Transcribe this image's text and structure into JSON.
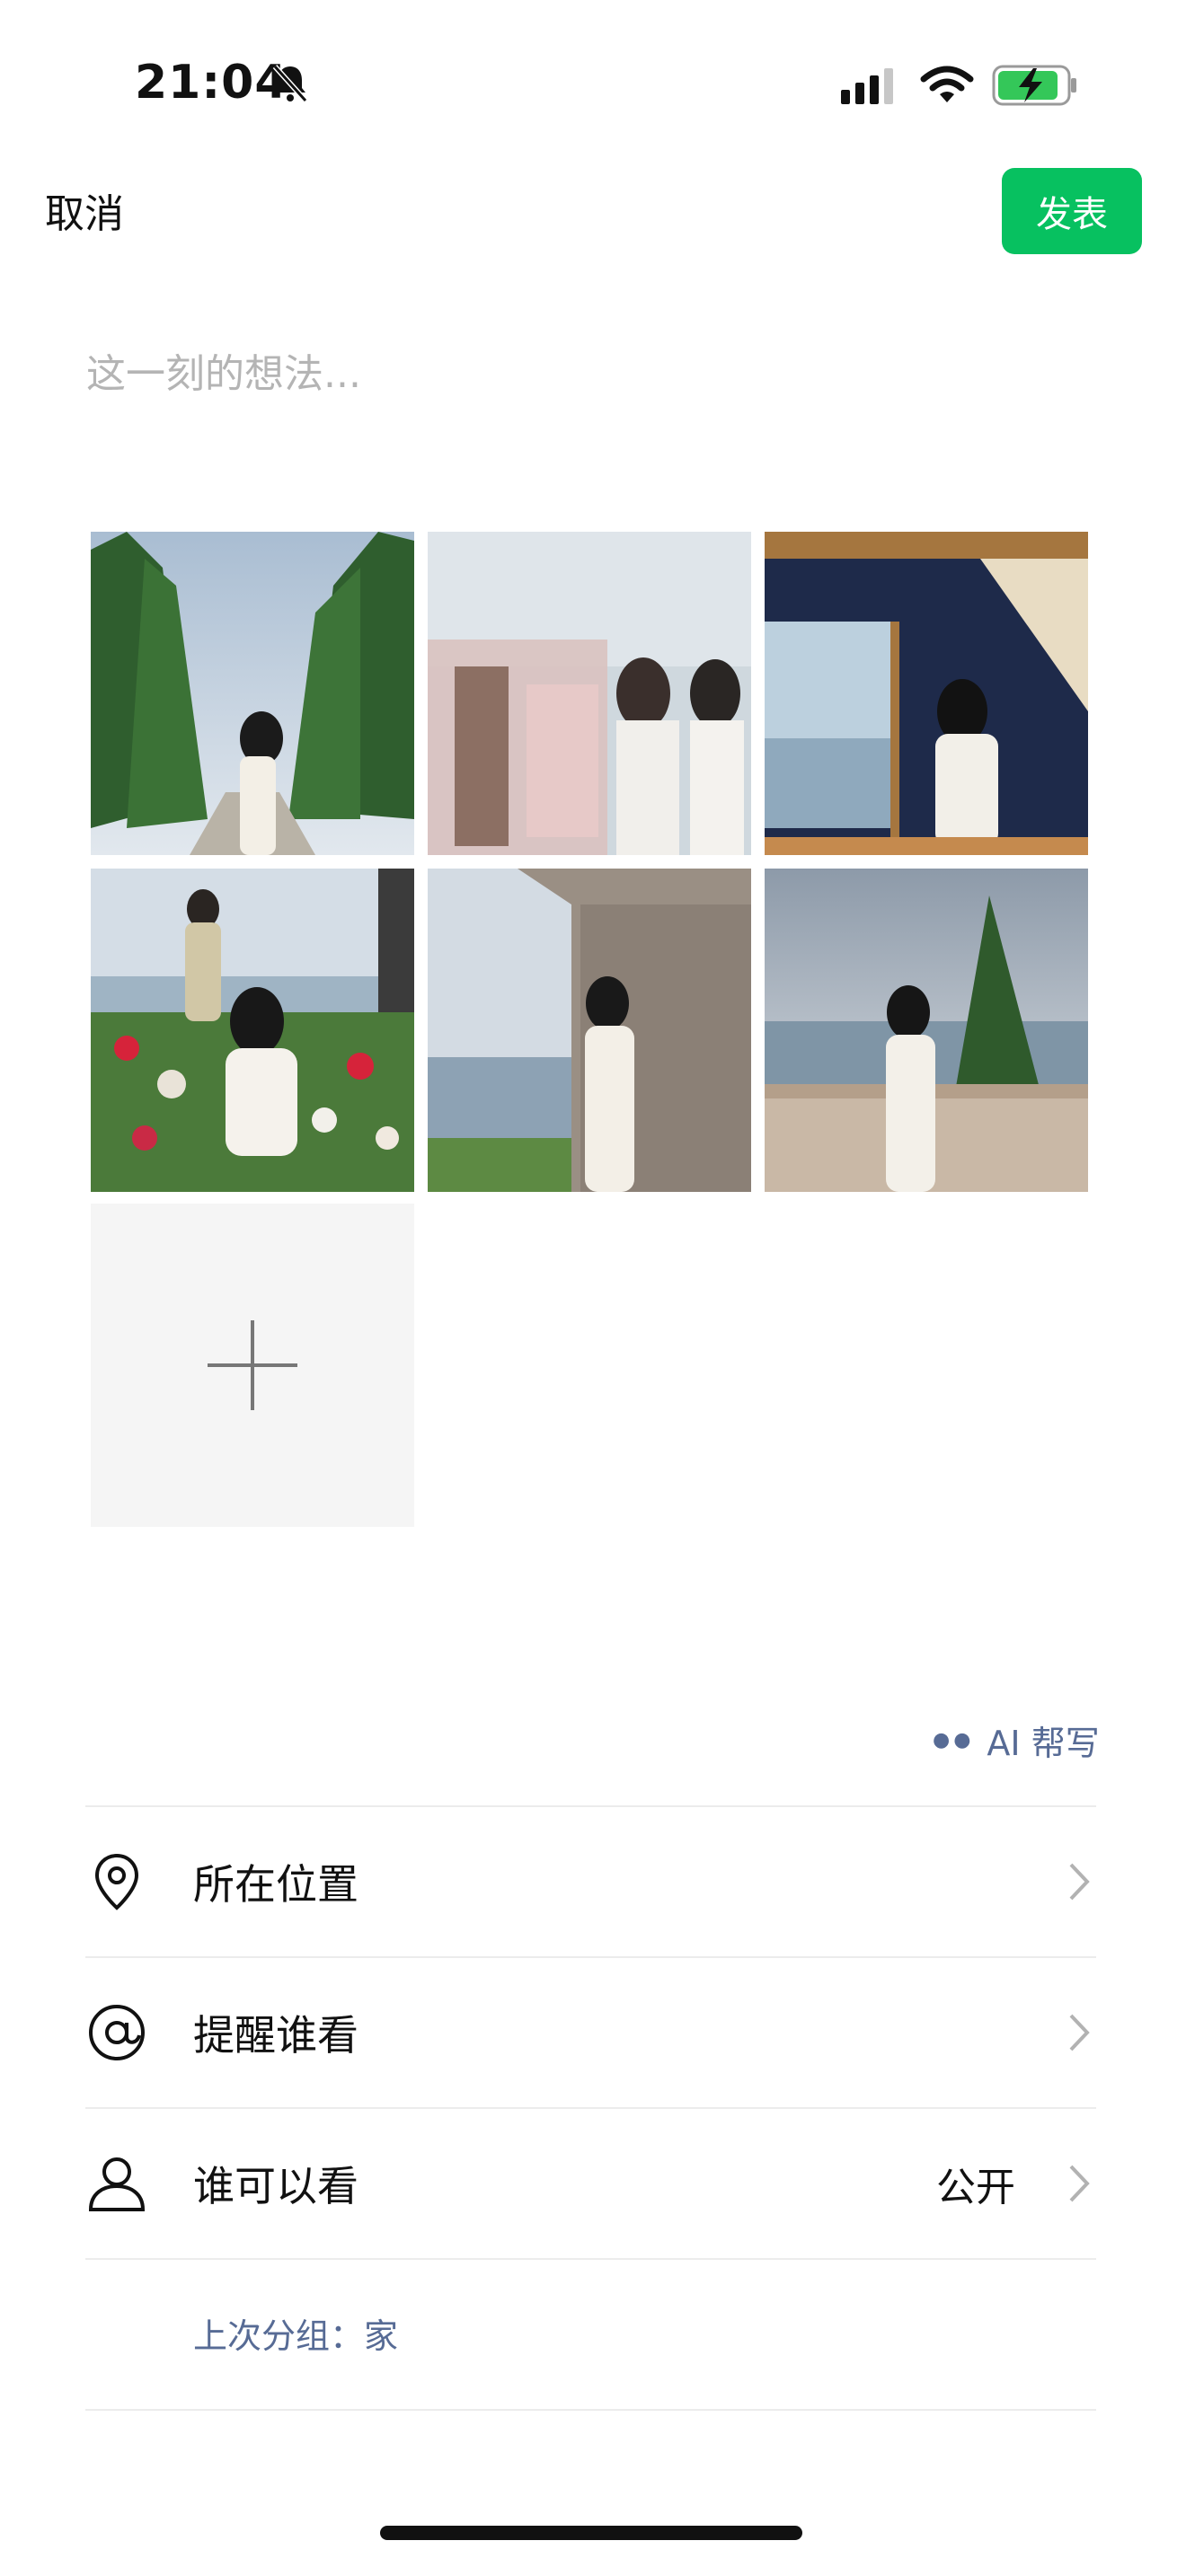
{
  "status_bar": {
    "time": "21:04",
    "battery_level": 0.8
  },
  "header": {
    "cancel": "取消",
    "post": "发表"
  },
  "composer": {
    "placeholder": "这一刻的想法..."
  },
  "ai_help": "AI 帮写",
  "rows": [
    {
      "label": "所在位置",
      "value": ""
    },
    {
      "label": "提醒谁看",
      "value": ""
    },
    {
      "label": "谁可以看",
      "value": "公开"
    }
  ],
  "last_group": "上次分组：家",
  "colors": {
    "accent": "#07c160",
    "link": "#576b95",
    "placeholder": "#b4b4b4"
  }
}
